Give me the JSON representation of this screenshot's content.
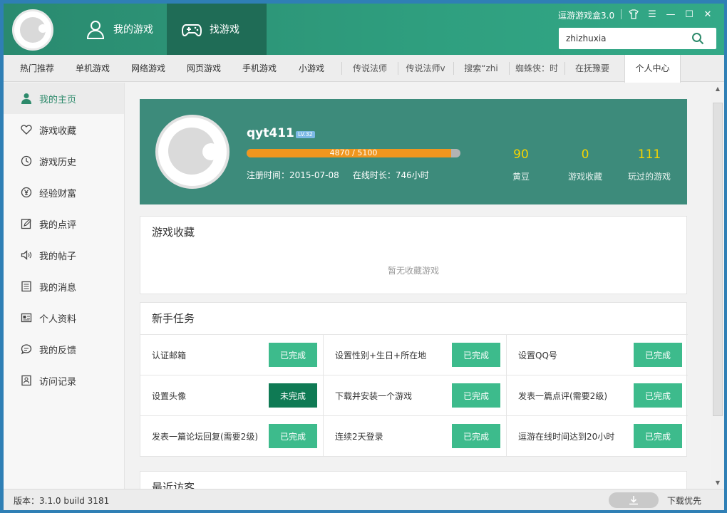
{
  "header": {
    "tabs": [
      {
        "label": "我的游戏",
        "icon": "user-icon"
      },
      {
        "label": "找游戏",
        "icon": "gamepad-icon"
      }
    ],
    "app_title": "逗游游戏盒3.0",
    "controls": [
      "skin-icon",
      "menu-icon",
      "minimize-icon",
      "maximize-icon",
      "close-icon"
    ],
    "search": {
      "value": "zhizhuxia",
      "icon": "search-icon"
    }
  },
  "tabs": [
    {
      "label": "热门推荐"
    },
    {
      "label": "单机游戏"
    },
    {
      "label": "网络游戏"
    },
    {
      "label": "网页游戏"
    },
    {
      "label": "手机游戏"
    },
    {
      "label": "小游戏"
    },
    {
      "label": "传说法师"
    },
    {
      "label": "传说法师v"
    },
    {
      "label": "搜索“zhi"
    },
    {
      "label": "蜘蛛侠：时"
    },
    {
      "label": "在抚豫要"
    },
    {
      "label": "个人中心"
    }
  ],
  "sidebar": {
    "items": [
      {
        "label": "我的主页",
        "icon": "person-icon"
      },
      {
        "label": "游戏收藏",
        "icon": "heart-icon"
      },
      {
        "label": "游戏历史",
        "icon": "clock-icon"
      },
      {
        "label": "经验财富",
        "icon": "yen-icon"
      },
      {
        "label": "我的点评",
        "icon": "edit-icon"
      },
      {
        "label": "我的帖子",
        "icon": "speaker-icon"
      },
      {
        "label": "我的消息",
        "icon": "message-icon"
      },
      {
        "label": "个人资料",
        "icon": "profile-card-icon"
      },
      {
        "label": "我的反馈",
        "icon": "chat-bubble-icon"
      },
      {
        "label": "访问记录",
        "icon": "record-icon"
      }
    ]
  },
  "profile": {
    "username": "qyt411",
    "level": "LV.32",
    "xp_text": "4870 / 5100",
    "xp_fraction": 0.955,
    "register": "注册时间：2015-07-08",
    "online": "在线时长：746小时",
    "stats": [
      {
        "value": "90",
        "label": "黄豆"
      },
      {
        "value": "0",
        "label": "游戏收藏"
      },
      {
        "value": "111",
        "label": "玩过的游戏"
      }
    ]
  },
  "favorites": {
    "title": "游戏收藏",
    "empty_text": "暂无收藏游戏"
  },
  "tasks": {
    "title": "新手任务",
    "items": [
      {
        "label": "认证邮箱",
        "status": "已完成",
        "done": true
      },
      {
        "label": "设置性别+生日+所在地",
        "status": "已完成",
        "done": true
      },
      {
        "label": "设置QQ号",
        "status": "已完成",
        "done": true
      },
      {
        "label": "设置头像",
        "status": "未完成",
        "done": false
      },
      {
        "label": "下载并安装一个游戏",
        "status": "已完成",
        "done": true
      },
      {
        "label": "发表一篇点评(需要2级)",
        "status": "已完成",
        "done": true
      },
      {
        "label": "发表一篇论坛回复(需要2级)",
        "status": "已完成",
        "done": true
      },
      {
        "label": "连续2天登录",
        "status": "已完成",
        "done": true
      },
      {
        "label": "逗游在线时间达到20小时",
        "status": "已完成",
        "done": true
      }
    ]
  },
  "visitors": {
    "title": "最近访客"
  },
  "footer": {
    "version": "版本：3.1.0 build 3181",
    "download_priority": "下载优先",
    "download_icon": "download-icon"
  },
  "colors": {
    "brand": "#2f9f7f",
    "profile_bg": "#3d8b7b",
    "done": "#3dbb8c",
    "pending": "#0f7a54",
    "xp": "#f0961e",
    "stat": "#f5d400"
  }
}
